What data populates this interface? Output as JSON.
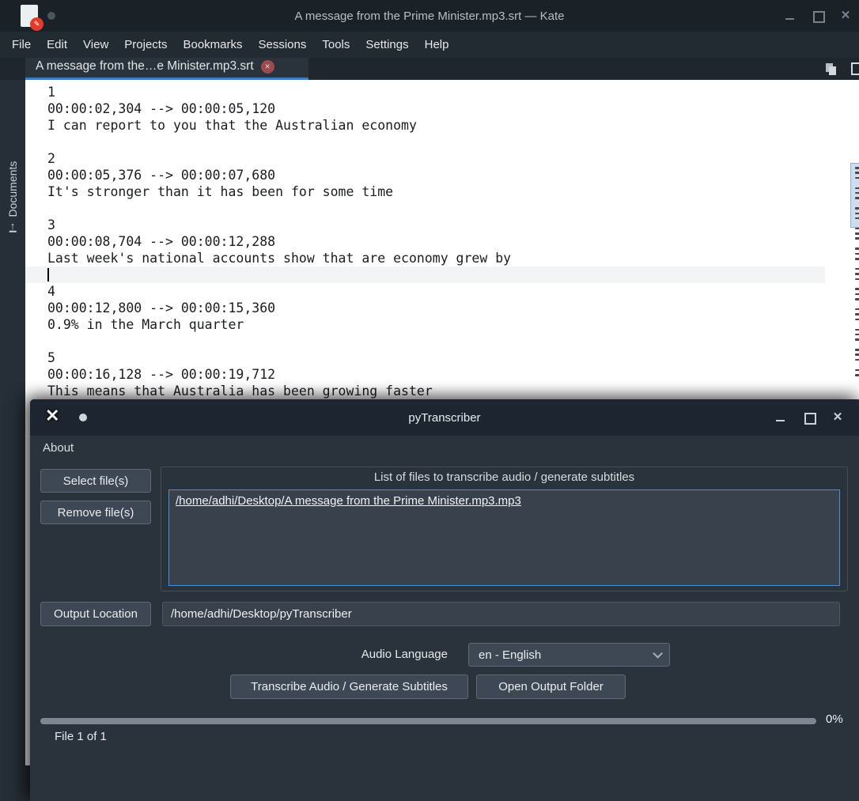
{
  "colors": {
    "accent_blue": "#4a90d9",
    "tab_underline": "#3d7cc0",
    "tab_close_badge": "#9b4b50",
    "kate_icon_badge": "#e23b2e",
    "progress_groove": "#7e8791"
  },
  "icons": {
    "pt_app_glyph": "✕",
    "tab_close_glyph": "✕",
    "kate_badge_glyph": "✎",
    "sidebar_arrow_glyph": "↑"
  },
  "kate": {
    "titlebar": {
      "title": "A message from the Prime Minister.mp3.srt — Kate"
    },
    "menu_items": [
      "File",
      "Edit",
      "View",
      "Projects",
      "Bookmarks",
      "Sessions",
      "Tools",
      "Settings",
      "Help"
    ],
    "tab_label": "A message from the…e Minister.mp3.srt",
    "sidebar_label": "Documents",
    "editor": {
      "cursor_line_index": 11,
      "lines": [
        "1",
        "00:00:02,304 --> 00:00:05,120",
        "I can report to you that the Australian economy",
        "",
        "2",
        "00:00:05,376 --> 00:00:07,680",
        "It's stronger than it has been for some time",
        "",
        "3",
        "00:00:08,704 --> 00:00:12,288",
        "Last week's national accounts show that are economy grew by",
        "",
        "4",
        "00:00:12,800 --> 00:00:15,360",
        "0.9% in the March quarter",
        "",
        "5",
        "00:00:16,128 --> 00:00:19,712",
        "This means that Australia has been growing faster"
      ]
    }
  },
  "pytranscriber": {
    "title": "pyTranscriber",
    "menu_about": "About",
    "select_button": "Select file(s)",
    "remove_button": "Remove file(s)",
    "filelist_title": "List of files to transcribe audio / generate subtitles",
    "files": [
      "/home/adhi/Desktop/A message from the Prime Minister.mp3.mp3"
    ],
    "output_location_button": "Output Location",
    "output_path": "/home/adhi/Desktop/pyTranscriber",
    "audio_language_label": "Audio Language",
    "audio_language_value": "en - English",
    "transcribe_button": "Transcribe Audio / Generate Subtitles",
    "open_output_button": "Open Output Folder",
    "progress_percent_label": "0%",
    "progress_value": 0,
    "file_status": "File 1 of 1"
  }
}
